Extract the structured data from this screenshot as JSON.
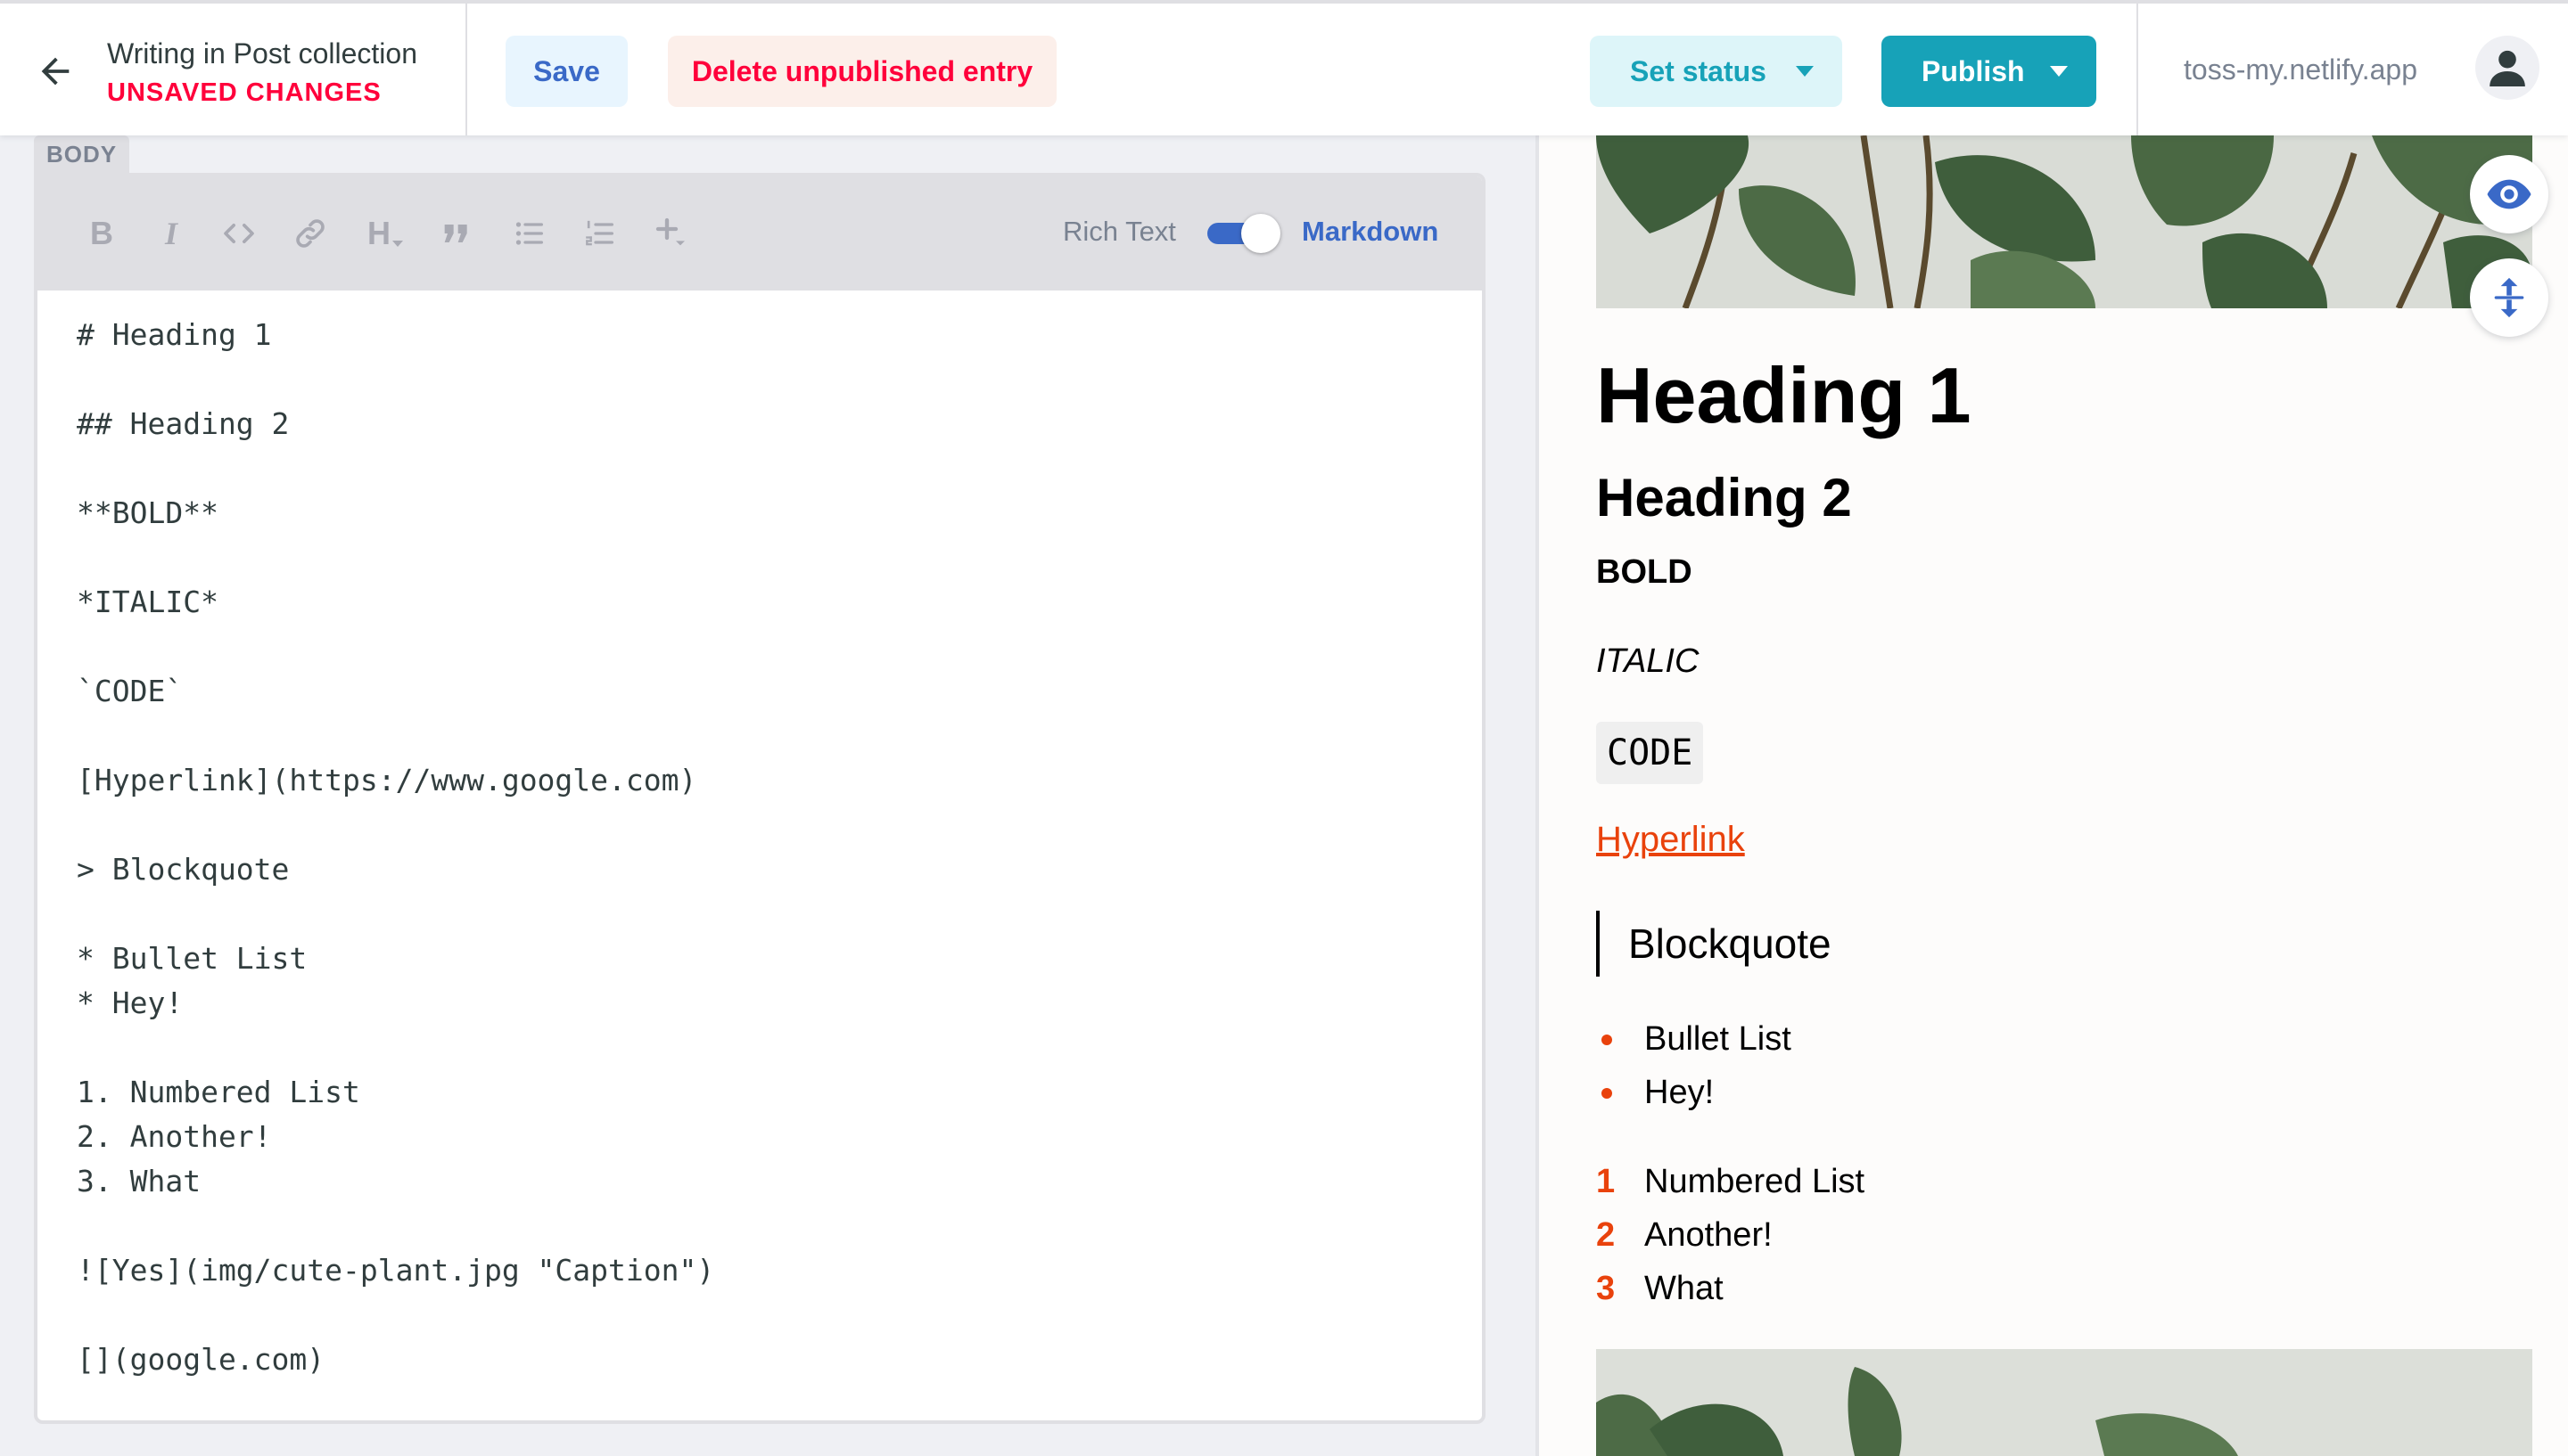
{
  "header": {
    "back_icon": "arrow-left-icon",
    "collection_label": "Writing in Post collection",
    "unsaved_label": "UNSAVED CHANGES",
    "save_label": "Save",
    "delete_label": "Delete unpublished entry",
    "set_status_label": "Set status",
    "publish_label": "Publish",
    "site_url": "toss-my.netlify.app",
    "avatar_icon": "user-avatar-icon"
  },
  "editor": {
    "field_label": "BODY",
    "toolbar": {
      "bold_label": "B",
      "italic_label": "I",
      "heading_label": "H",
      "rich_text_label": "Rich Text",
      "markdown_label": "Markdown",
      "markdown_mode_on": true
    },
    "lines": [
      "# Heading 1",
      "## Heading 2",
      "**BOLD**",
      "*ITALIC*",
      "`CODE`",
      "[Hyperlink](https://www.google.com)",
      "> Blockquote",
      "* Bullet List",
      "* Hey!",
      "1. Numbered List",
      "2. Another!",
      "3. What",
      "![Yes](img/cute-plant.jpg \"Caption\")",
      "[](google.com)"
    ]
  },
  "preview": {
    "heading1": "Heading 1",
    "heading2": "Heading 2",
    "bold": "BOLD",
    "italic": "ITALIC",
    "code": "CODE",
    "link": "Hyperlink",
    "blockquote": "Blockquote",
    "bullets": [
      "Bullet List",
      "Hey!"
    ],
    "numbered": [
      {
        "num": "1",
        "text": "Numbered List"
      },
      {
        "num": "2",
        "text": "Another!"
      },
      {
        "num": "3",
        "text": "What"
      }
    ],
    "preview_toggle_icon": "eye-icon",
    "scroll_sync_icon": "scroll-sync-icon"
  },
  "colors": {
    "accent_blue": "#3a69c7",
    "publish_teal": "#17a2b8",
    "danger_red": "#ff003b",
    "preview_accent": "#e9420c"
  }
}
